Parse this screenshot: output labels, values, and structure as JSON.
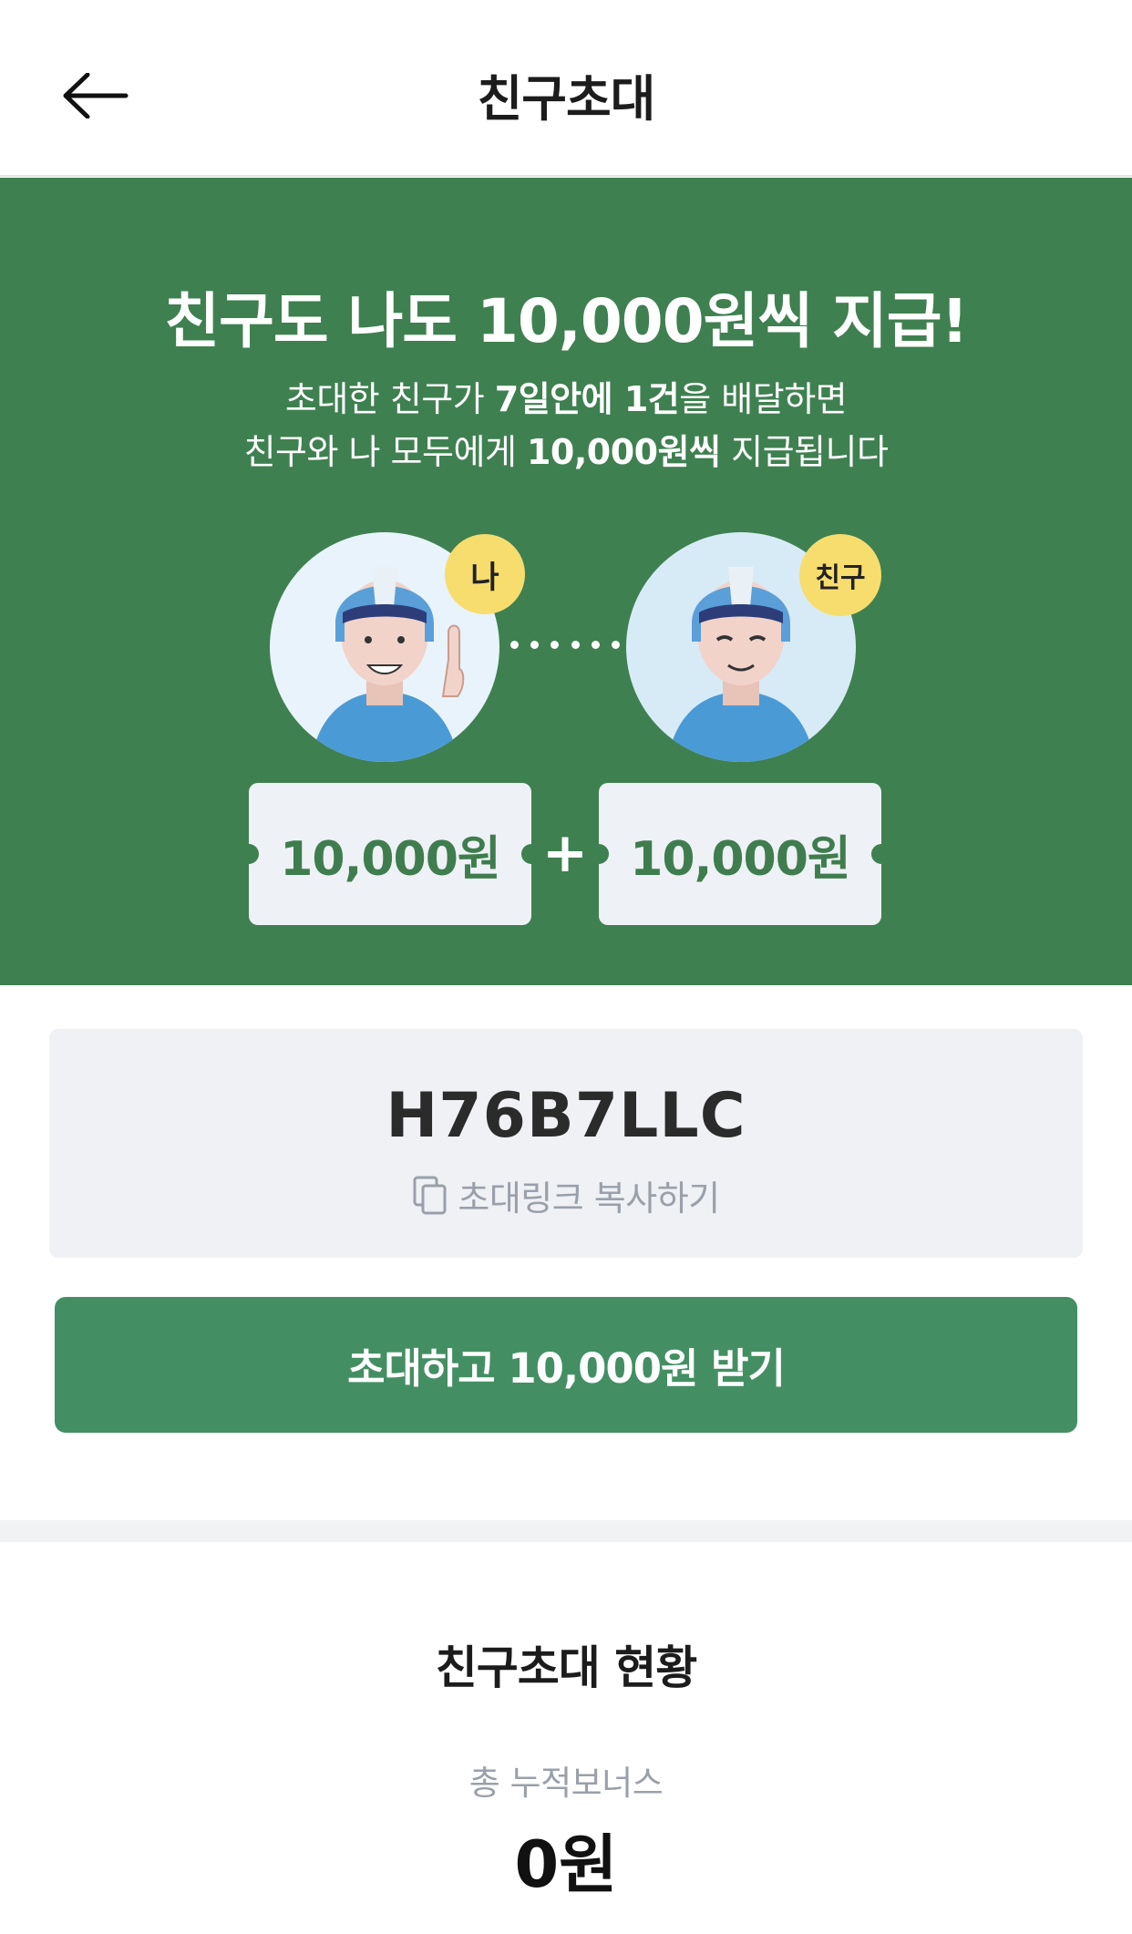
{
  "header": {
    "title": "친구초대",
    "back_icon": "arrow-left-icon"
  },
  "hero": {
    "title": "친구도 나도 10,000원씩 지급!",
    "desc_line1": {
      "p1": "초대한 친구가 ",
      "b1": "7일안에 1건",
      "p2": "을 배달하면"
    },
    "desc_line2": {
      "p1": "친구와 나 모두에게 ",
      "b1": "10,000원씩",
      "p2": " 지급됩니다"
    },
    "badge_me": "나",
    "badge_friend": "친구",
    "coupon_me": "10,000원",
    "coupon_friend": "10,000원",
    "plus": "+",
    "bg_color": "#3f8050"
  },
  "invite": {
    "code": "H76B7LLC",
    "copy_label": "초대링크 복사하기",
    "copy_icon": "copy-icon"
  },
  "cta": {
    "label": "초대하고 10,000원 받기",
    "color": "#438f63"
  },
  "status": {
    "title": "친구초대 현황",
    "bonus_label": "총 누적보너스",
    "bonus_value": "0원"
  }
}
